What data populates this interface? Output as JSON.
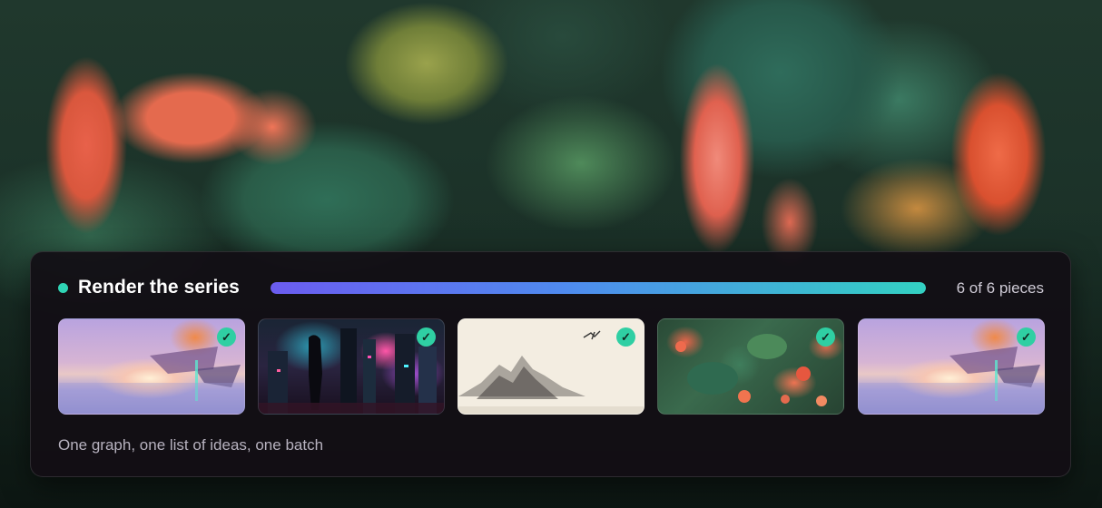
{
  "panel": {
    "title": "Render the series",
    "progress": {
      "completed": 6,
      "total": 6,
      "fraction": 1.0
    },
    "count_label": "6 of 6 pieces",
    "subtitle": "One graph, one list of ideas, one batch"
  },
  "thumbnails": [
    {
      "check": "✓",
      "status": "complete"
    },
    {
      "check": "✓",
      "status": "complete"
    },
    {
      "check": "✓",
      "status": "complete"
    },
    {
      "check": "✓",
      "status": "complete"
    },
    {
      "check": "✓",
      "status": "complete"
    }
  ],
  "colors": {
    "accent_teal": "#2fd4b5",
    "progress_start": "#6b5cf0",
    "progress_end": "#33d1c2",
    "panel_bg": "#120e14",
    "check_bg": "#2fcfa3"
  },
  "icons": {
    "status": "status-dot",
    "thumbnail_check": "check-icon"
  }
}
